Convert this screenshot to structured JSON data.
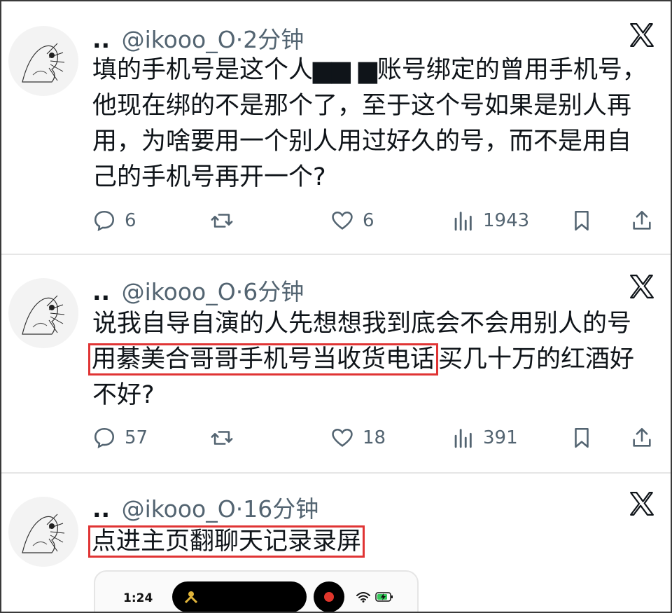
{
  "tweets": [
    {
      "handle_dots": "..",
      "handle": "@ikooo_O",
      "separator": "·",
      "time": "2分钟",
      "lines": [
        "填的手机号是这个人▆▆ ▆账号绑定的曾用手机号，",
        "他现在绑的不是那个了，至于这个号如果是别人再",
        "用，为啥要用一个别人用过好久的号，而不是用自",
        "己的手机号再开一个?"
      ],
      "reply_count": "6",
      "like_count": "6",
      "view_count": "1943"
    },
    {
      "handle_dots": "..",
      "handle": "@ikooo_O",
      "separator": "·",
      "time": "6分钟",
      "line1": "说我自导自演的人先想想我到底会不会用别人的号",
      "line2_boxed": "用綦美合哥哥手机号当收货电话",
      "line2_rest": "买几十万的红酒好",
      "line3": "不好?",
      "reply_count": "57",
      "like_count": "18",
      "view_count": "391"
    },
    {
      "handle_dots": "..",
      "handle": "@ikooo_O",
      "separator": "·",
      "time": "16分钟",
      "line1_boxed": "点进主页翻聊天记录录屏"
    }
  ],
  "embedded_screenshot": {
    "time": "1:24"
  },
  "colors": {
    "highlight_box": "#e03434",
    "muted_text": "#536471"
  }
}
